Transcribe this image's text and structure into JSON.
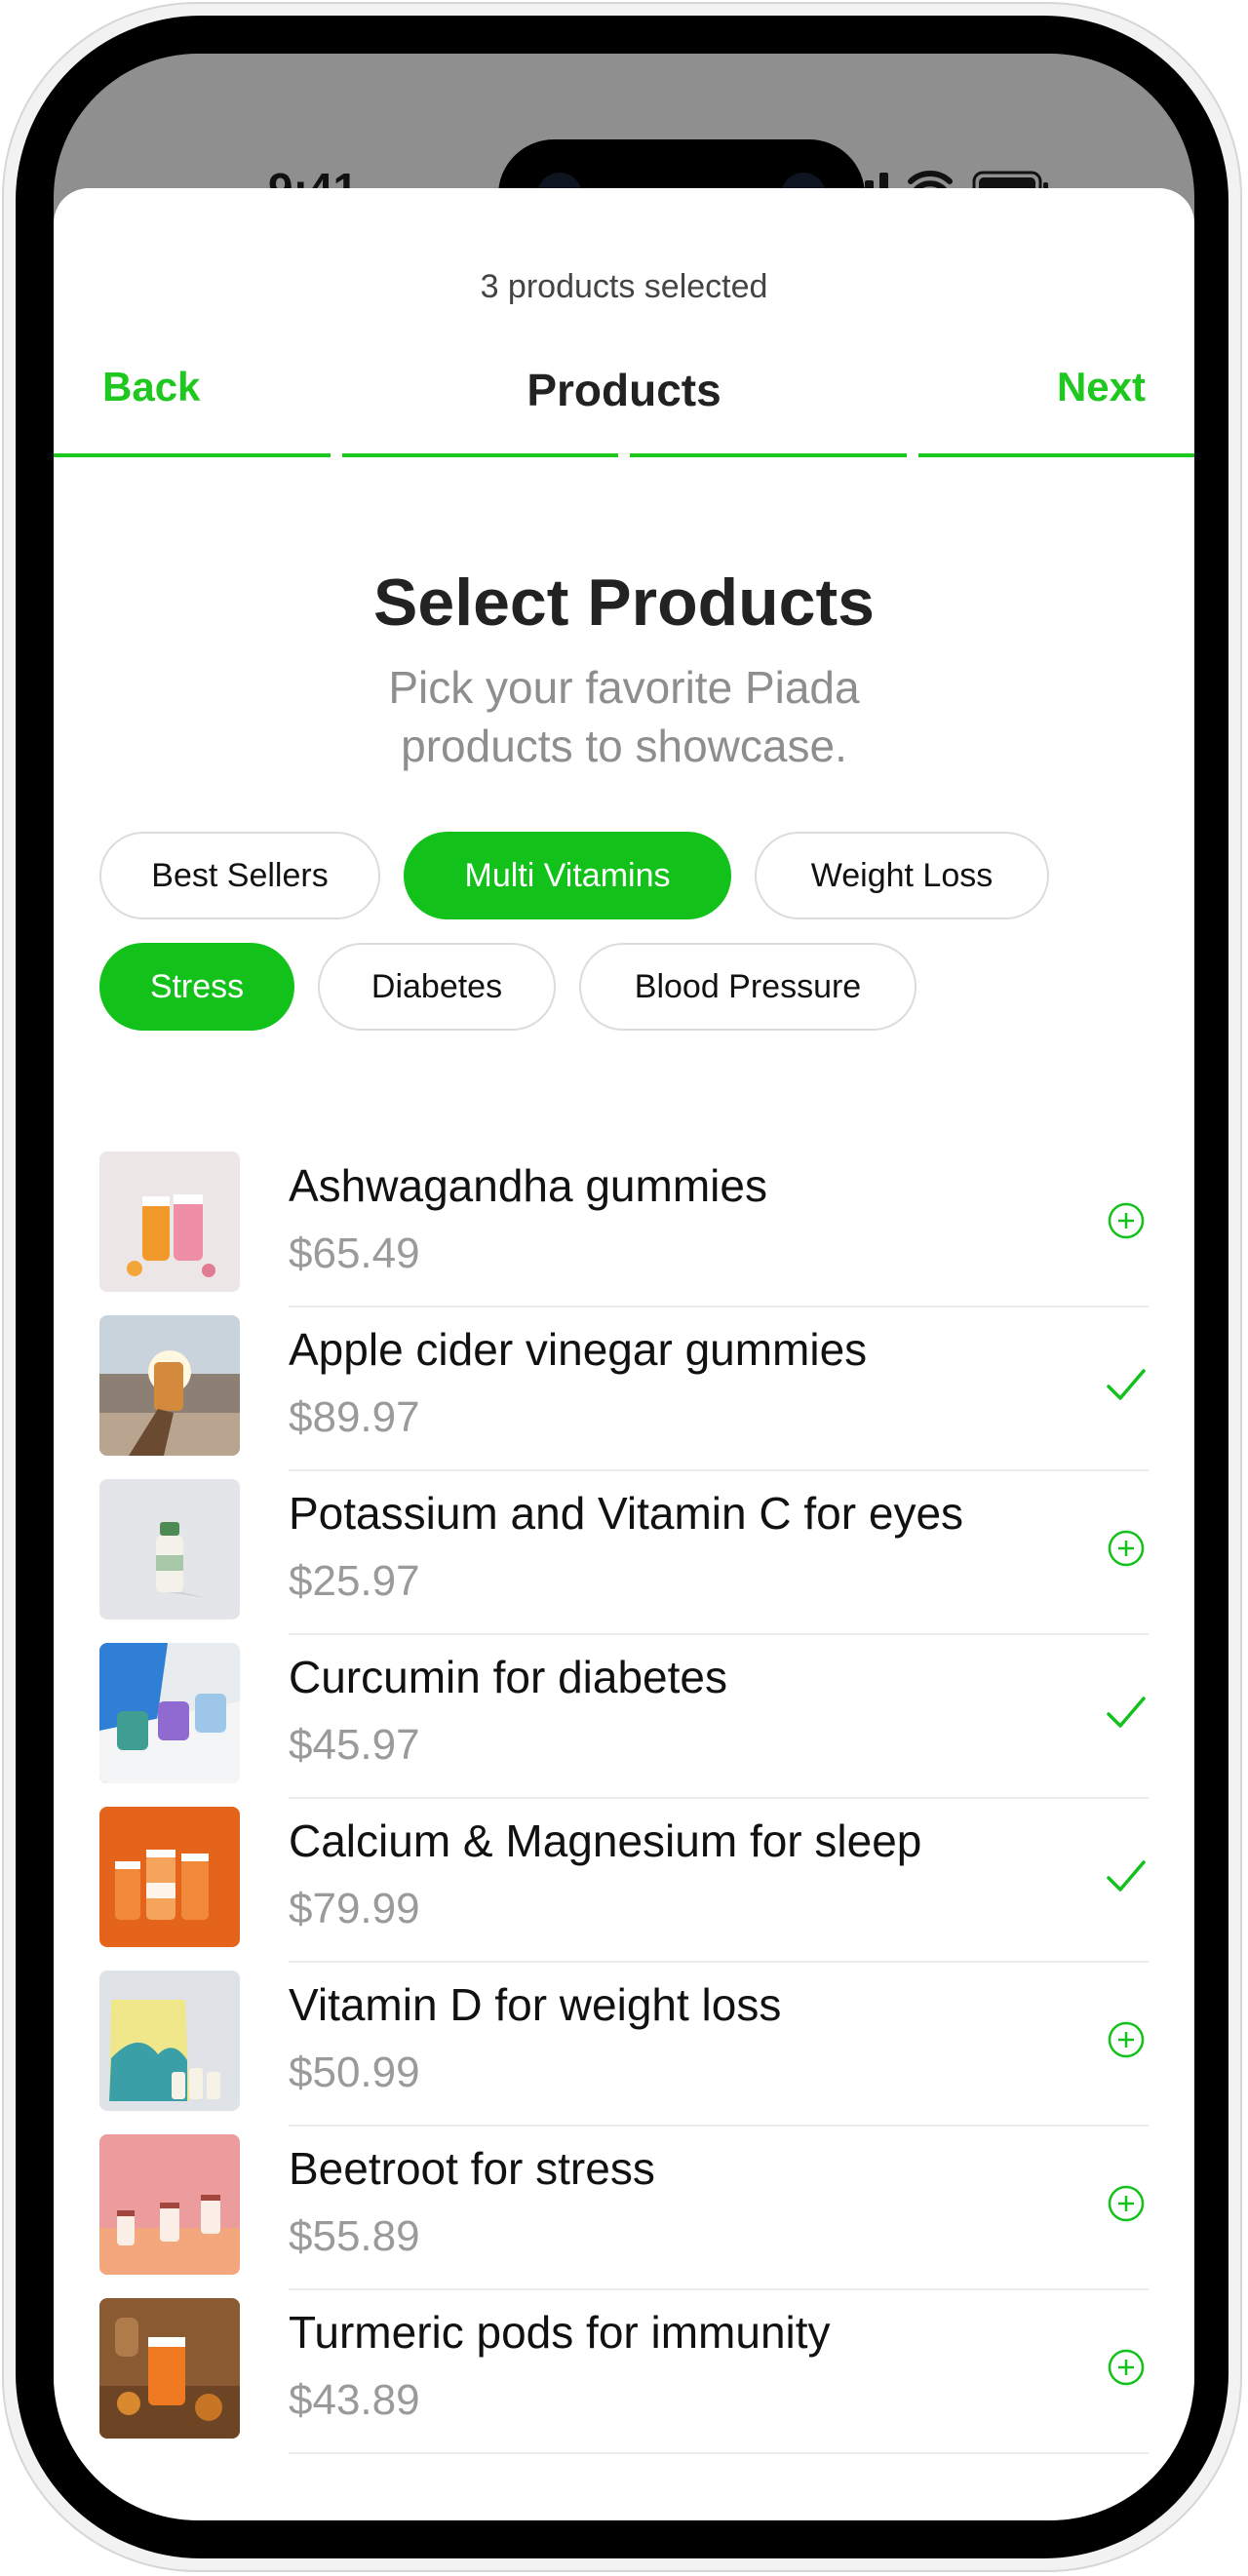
{
  "status_bar": {
    "time": "9:41"
  },
  "header": {
    "selection_count": "3 products selected",
    "back_label": "Back",
    "title": "Products",
    "next_label": "Next"
  },
  "hero": {
    "title": "Select Products",
    "subtitle": "Pick your favorite Piada products to showcase."
  },
  "filters": [
    {
      "label": "Best Sellers",
      "active": false
    },
    {
      "label": "Multi Vitamins",
      "active": true
    },
    {
      "label": "Weight Loss",
      "active": false
    },
    {
      "label": "Stress",
      "active": true
    },
    {
      "label": "Diabetes",
      "active": false
    },
    {
      "label": "Blood Pressure",
      "active": false
    }
  ],
  "products": [
    {
      "name": "Ashwagandha gummies",
      "price": "$65.49",
      "selected": false
    },
    {
      "name": "Apple cider vinegar gummies",
      "price": "$89.97",
      "selected": true
    },
    {
      "name": "Potassium and Vitamin C for eyes",
      "price": "$25.97",
      "selected": false
    },
    {
      "name": "Curcumin for diabetes",
      "price": "$45.97",
      "selected": true
    },
    {
      "name": "Calcium & Magnesium for sleep",
      "price": "$79.99",
      "selected": true
    },
    {
      "name": "Vitamin D for weight loss",
      "price": "$50.99",
      "selected": false
    },
    {
      "name": "Beetroot for stress",
      "price": "$55.89",
      "selected": false
    },
    {
      "name": "Turmeric pods for immunity",
      "price": "$43.89",
      "selected": false
    }
  ],
  "icons": {
    "add": "plus-circle-icon",
    "selected": "checkmark-icon"
  },
  "colors": {
    "accent": "#12c21a",
    "text_primary": "#111111",
    "text_secondary": "#8e8e8e"
  }
}
